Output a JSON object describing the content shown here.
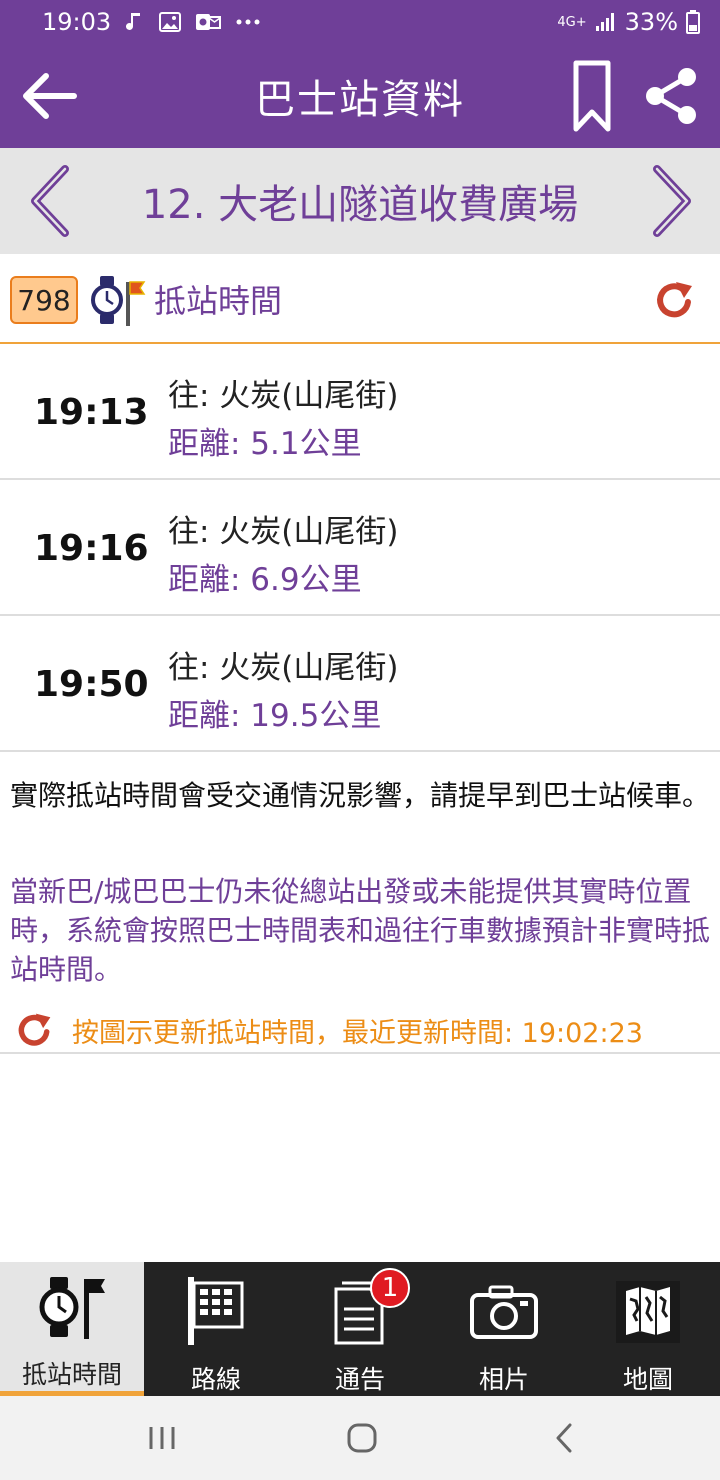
{
  "status_bar": {
    "time": "19:03",
    "network": "4G+",
    "battery": "33%"
  },
  "app_bar": {
    "title": "巴士站資料"
  },
  "stop": {
    "name": "12. 大老山隧道收費廣場"
  },
  "eta_header": {
    "route": "798",
    "title": "抵站時間"
  },
  "etas": [
    {
      "time": "19:13",
      "destination": "往: 火炭(山尾街)",
      "distance": "距離: 5.1公里"
    },
    {
      "time": "19:16",
      "destination": "往: 火炭(山尾街)",
      "distance": "距離: 6.9公里"
    },
    {
      "time": "19:50",
      "destination": "往: 火炭(山尾街)",
      "distance": "距離: 19.5公里"
    }
  ],
  "notes": {
    "traffic": "實際抵站時間會受交通情況影響，請提早到巴士站候車。",
    "realtime": "當新巴/城巴巴士仍未從總站出發或未能提供其實時位置時，系統會按照巴士時間表和過往行車數據預計非實時抵站時間。",
    "update": "按圖示更新抵站時間，最近更新時間: 19:02:23"
  },
  "bottom_nav": {
    "items": [
      {
        "label": "抵站時間"
      },
      {
        "label": "路線"
      },
      {
        "label": "通告",
        "badge": "1"
      },
      {
        "label": "相片"
      },
      {
        "label": "地圖"
      }
    ]
  },
  "colors": {
    "primary": "#6f3f98",
    "accent": "#f0a33a",
    "refresh": "#c8432f",
    "badge": "#e01a22"
  },
  "icons": {
    "back": "arrow-left-icon",
    "bookmark": "bookmark-icon",
    "share": "share-icon",
    "prev": "chevron-left-icon",
    "next": "chevron-right-icon",
    "refresh": "refresh-icon"
  }
}
